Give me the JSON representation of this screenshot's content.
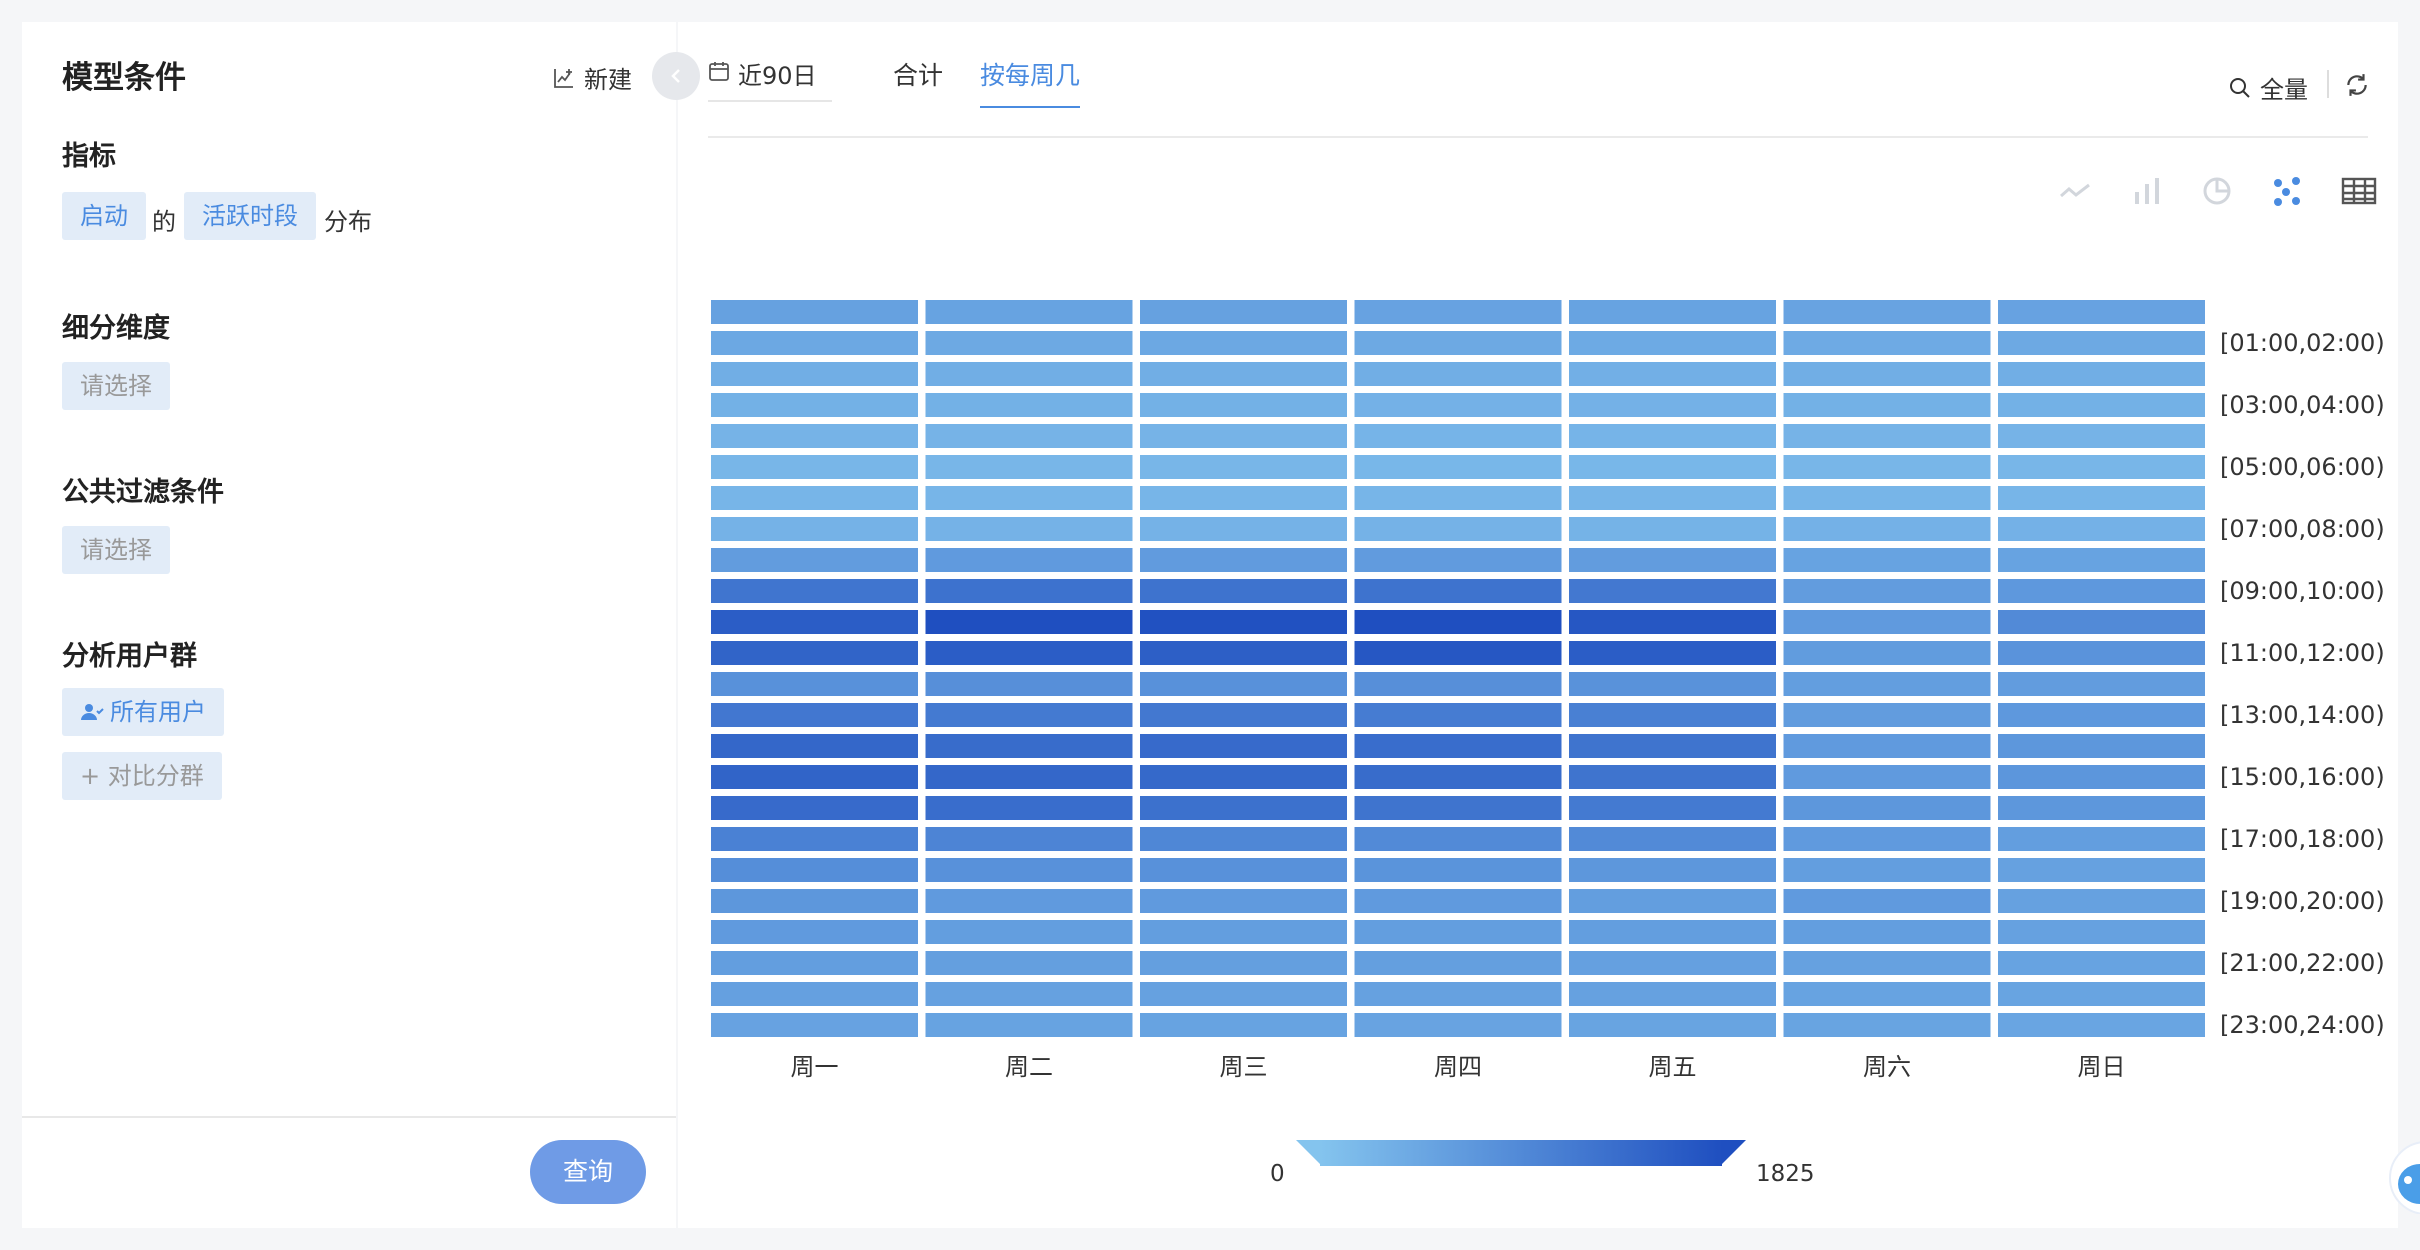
{
  "left_panel": {
    "title": "模型条件",
    "new_label": "新建",
    "metric": {
      "section": "指标",
      "event": "启动",
      "connector": "的",
      "measure": "活跃时段",
      "suffix": "分布"
    },
    "breakdown": {
      "section": "细分维度",
      "placeholder": "请选择"
    },
    "filter": {
      "section": "公共过滤条件",
      "placeholder": "请选择"
    },
    "segment": {
      "section": "分析用户群",
      "all_users": "所有用户",
      "compare": "+ 对比分群"
    },
    "query_label": "查询"
  },
  "toolbar": {
    "date_range": "近90日",
    "tabs": [
      {
        "label": "合计",
        "active": false
      },
      {
        "label": "按每周几",
        "active": true
      }
    ],
    "scope_label": "全量"
  },
  "chart_icons": [
    "line-chart-icon",
    "bar-chart-icon",
    "pie-chart-icon",
    "scatter-chart-icon",
    "table-icon"
  ],
  "colors": {
    "accent": "#4a8be0",
    "heat_low": "#84c4ee",
    "heat_high": "#1f4fc0"
  },
  "chart_data": {
    "type": "heatmap",
    "x_categories": [
      "周一",
      "周二",
      "周三",
      "周四",
      "周五",
      "周六",
      "周日"
    ],
    "y_tick_labels": [
      "[01:00,02:00)",
      "[03:00,04:00)",
      "[05:00,06:00)",
      "[07:00,08:00)",
      "[09:00,10:00)",
      "[11:00,12:00)",
      "[13:00,14:00)",
      "[15:00,16:00)",
      "[17:00,18:00)",
      "[19:00,20:00)",
      "[21:00,22:00)",
      "[23:00,24:00)"
    ],
    "values": [
      [
        540,
        520,
        540,
        530,
        520,
        510,
        530
      ],
      [
        430,
        420,
        430,
        420,
        410,
        400,
        420
      ],
      [
        350,
        350,
        350,
        340,
        330,
        340,
        340
      ],
      [
        300,
        300,
        300,
        290,
        290,
        300,
        300
      ],
      [
        260,
        260,
        260,
        250,
        250,
        260,
        260
      ],
      [
        220,
        220,
        220,
        210,
        210,
        220,
        220
      ],
      [
        240,
        240,
        240,
        240,
        230,
        240,
        240
      ],
      [
        280,
        280,
        280,
        280,
        270,
        290,
        290
      ],
      [
        620,
        650,
        640,
        640,
        620,
        520,
        520
      ],
      [
        1230,
        1280,
        1270,
        1270,
        1180,
        620,
        680
      ],
      [
        1600,
        1825,
        1790,
        1825,
        1700,
        650,
        900
      ],
      [
        1500,
        1600,
        1580,
        1700,
        1600,
        630,
        760
      ],
      [
        800,
        820,
        800,
        820,
        780,
        600,
        620
      ],
      [
        1200,
        1150,
        1180,
        1120,
        1060,
        620,
        680
      ],
      [
        1450,
        1380,
        1400,
        1350,
        1250,
        650,
        700
      ],
      [
        1500,
        1450,
        1420,
        1380,
        1250,
        650,
        720
      ],
      [
        1400,
        1350,
        1300,
        1250,
        1150,
        700,
        700
      ],
      [
        1050,
        1000,
        950,
        900,
        900,
        650,
        600
      ],
      [
        850,
        800,
        800,
        750,
        700,
        600,
        550
      ],
      [
        700,
        650,
        650,
        650,
        600,
        650,
        550
      ],
      [
        650,
        600,
        600,
        600,
        600,
        600,
        550
      ],
      [
        600,
        580,
        580,
        580,
        560,
        550,
        520
      ],
      [
        560,
        540,
        540,
        540,
        540,
        520,
        500
      ],
      [
        530,
        520,
        520,
        510,
        500,
        500,
        480
      ]
    ],
    "color_scale": {
      "min": 0,
      "max": 1825
    },
    "legend": {
      "min_label": "0",
      "max_label": "1825"
    }
  }
}
